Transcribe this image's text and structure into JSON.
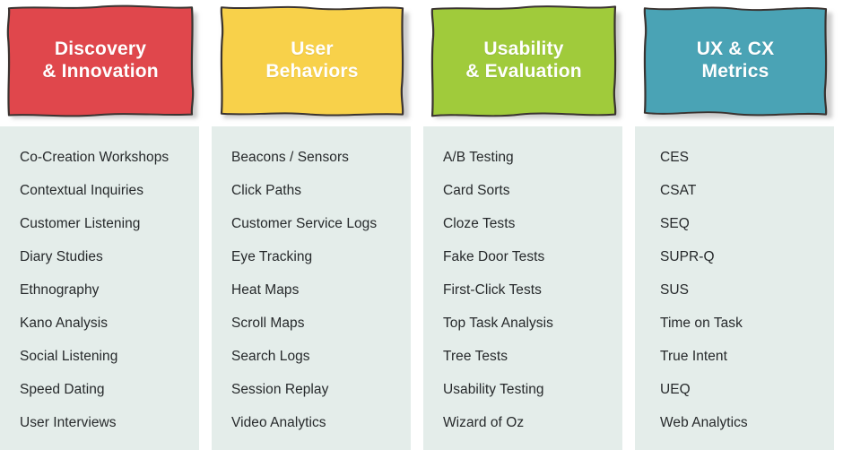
{
  "diagram": {
    "type": "four-column-category-grid",
    "background_color": "#ffffff",
    "list_panel_color": "#e4edea",
    "list_text_color": "#26292b",
    "header_text_color": "#ffffff",
    "columns": [
      {
        "id": "discovery-innovation",
        "title_line1": "Discovery",
        "title_line2": "& Innovation",
        "color": "#e0474c",
        "outline_color": "#3a3330",
        "items": [
          "Co-Creation Workshops",
          "Contextual Inquiries",
          "Customer Listening",
          "Diary Studies",
          "Ethnography",
          "Kano Analysis",
          "Social Listening",
          "Speed Dating",
          "User Interviews"
        ]
      },
      {
        "id": "user-behaviors",
        "title_line1": "User",
        "title_line2": "Behaviors",
        "color": "#f8d14a",
        "outline_color": "#3a3330",
        "items": [
          "Beacons / Sensors",
          "Click Paths",
          "Customer Service Logs",
          "Eye Tracking",
          "Heat Maps",
          "Scroll Maps",
          "Search Logs",
          "Session Replay",
          "Video Analytics"
        ]
      },
      {
        "id": "usability-evaluation",
        "title_line1": "Usability",
        "title_line2": "& Evaluation",
        "color": "#a0cb3b",
        "outline_color": "#3a3330",
        "items": [
          "A/B Testing",
          "Card Sorts",
          "Cloze Tests",
          "Fake Door Tests",
          "First-Click Tests",
          "Top Task Analysis",
          "Tree Tests",
          "Usability Testing",
          "Wizard of Oz"
        ]
      },
      {
        "id": "ux-cx-metrics",
        "title_line1": "UX & CX",
        "title_line2": "Metrics",
        "color": "#4aa3b5",
        "outline_color": "#3a3330",
        "items": [
          "CES",
          "CSAT",
          "SEQ",
          "SUPR-Q",
          "SUS",
          "Time on Task",
          "True Intent",
          "UEQ",
          "Web Analytics"
        ]
      }
    ]
  }
}
